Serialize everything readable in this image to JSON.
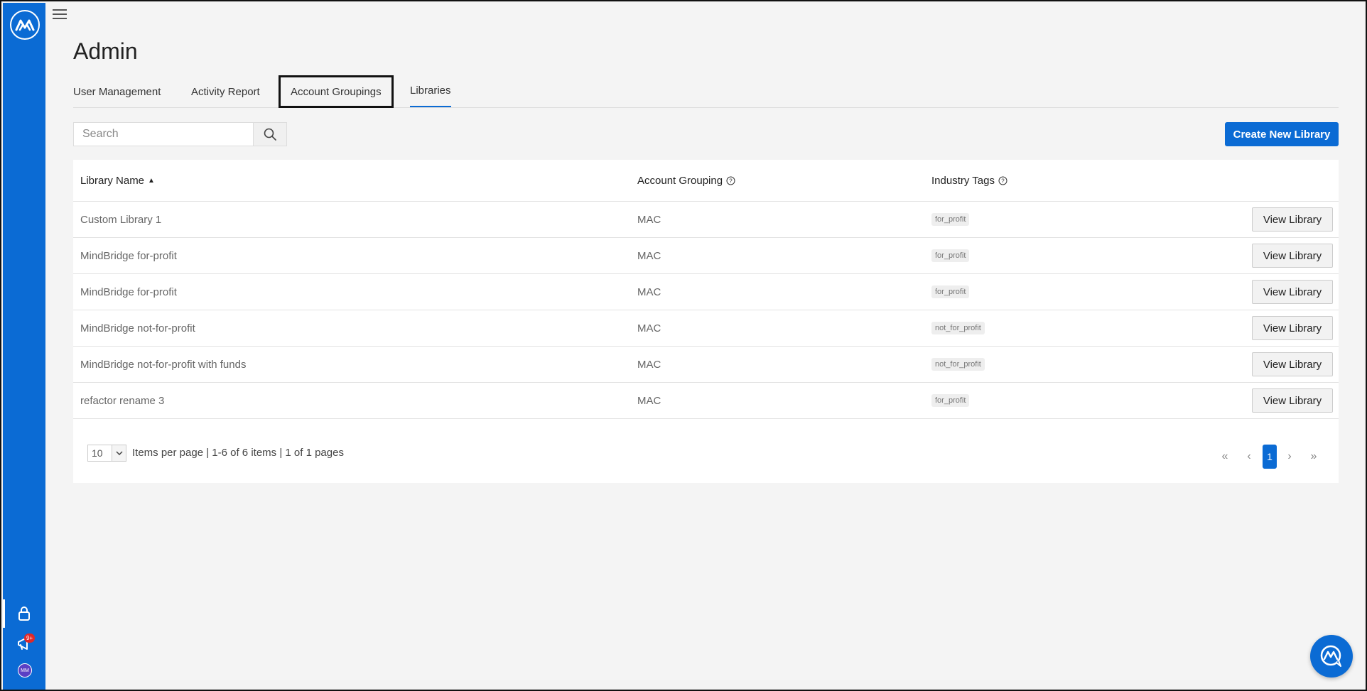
{
  "app": {
    "brand_color": "#0b6bd4"
  },
  "sidebar": {
    "logo_icon": "mindbridge-logo-icon",
    "items": [
      {
        "icon": "lock-icon"
      },
      {
        "icon": "megaphone-icon",
        "badge": "9+"
      },
      {
        "icon": "avatar",
        "initials": "MM"
      }
    ]
  },
  "page": {
    "title": "Admin"
  },
  "tabs": [
    {
      "label": "User Management"
    },
    {
      "label": "Activity Report"
    },
    {
      "label": "Account Groupings"
    },
    {
      "label": "Libraries"
    }
  ],
  "toolbar": {
    "search_placeholder": "Search",
    "create_label": "Create New Library"
  },
  "table": {
    "columns": [
      "Library Name",
      "Account Grouping",
      "Industry Tags"
    ],
    "rows": [
      {
        "name": "Custom Library 1",
        "grouping": "MAC",
        "tag": "for_profit",
        "action": "View Library"
      },
      {
        "name": "MindBridge for-profit",
        "grouping": "MAC",
        "tag": "for_profit",
        "action": "View Library"
      },
      {
        "name": "MindBridge for-profit",
        "grouping": "MAC",
        "tag": "for_profit",
        "action": "View Library"
      },
      {
        "name": "MindBridge not-for-profit",
        "grouping": "MAC",
        "tag": "not_for_profit",
        "action": "View Library"
      },
      {
        "name": "MindBridge not-for-profit with funds",
        "grouping": "MAC",
        "tag": "not_for_profit",
        "action": "View Library"
      },
      {
        "name": "refactor rename 3",
        "grouping": "MAC",
        "tag": "for_profit",
        "action": "View Library"
      }
    ]
  },
  "pager": {
    "per_page": "10",
    "info": "Items per page | 1-6 of 6 items | 1 of 1 pages",
    "current_page": "1",
    "first": "«",
    "prev": "‹",
    "next": "›",
    "last": "»"
  }
}
